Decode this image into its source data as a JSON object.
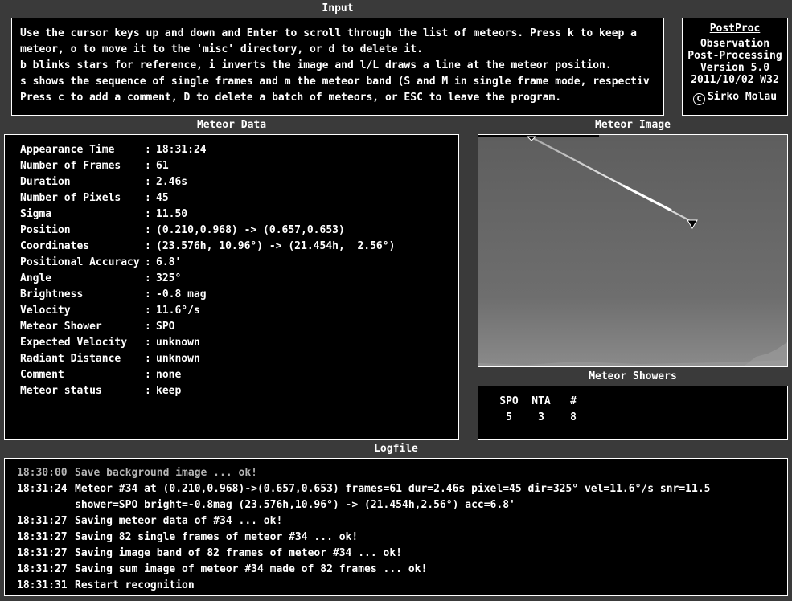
{
  "input": {
    "title": "Input",
    "lines": [
      "Use the cursor keys up and down and Enter to scroll through the list of meteors. Press k to keep a",
      "meteor, o to move it to the 'misc' directory, or d to delete it.",
      "b blinks stars for reference, i inverts the image and l/L draws a line at the meteor position.",
      "s shows the sequence of single frames and m the meteor band (S and M in single frame mode, respectiv",
      "Press c to add a comment, D to delete a batch of meteors, or ESC to leave the program."
    ]
  },
  "info": {
    "link": "PostProc",
    "line1": "Observation",
    "line2": "Post-Processing",
    "line3": "Version 5.0",
    "line4": "2011/10/02 W32",
    "copyright_symbol": "C",
    "copyright": "Sirko Molau"
  },
  "meteor_data": {
    "title": "Meteor Data",
    "separator": ":",
    "rows": [
      {
        "label": "Appearance Time",
        "value": "18:31:24"
      },
      {
        "label": "Number of Frames",
        "value": "61"
      },
      {
        "label": "Duration",
        "value": "2.46s"
      },
      {
        "label": "Number of Pixels",
        "value": "45"
      },
      {
        "label": "Sigma",
        "value": "11.50"
      },
      {
        "label": "Position",
        "value": "(0.210,0.968) -> (0.657,0.653)"
      },
      {
        "label": "Coordinates",
        "value": "(23.576h, 10.96°) -> (21.454h,  2.56°)"
      },
      {
        "label": "Positional Accuracy",
        "value": "6.8'"
      },
      {
        "label": "Angle",
        "value": "325°"
      },
      {
        "label": "Brightness",
        "value": "-0.8 mag"
      },
      {
        "label": "Velocity",
        "value": "11.6°/s"
      },
      {
        "label": "Meteor Shower",
        "value": "SPO"
      },
      {
        "label": "Expected Velocity",
        "value": "unknown"
      },
      {
        "label": "Radiant Distance",
        "value": "unknown"
      },
      {
        "label": "Comment",
        "value": "none"
      },
      {
        "label": "Meteor status",
        "value": "keep"
      }
    ]
  },
  "meteor_image": {
    "title": "Meteor Image",
    "start_marker_icon": "triangle-marker-icon",
    "end_marker_icon": "triangle-marker-icon",
    "sky_color": "#6b6b6b"
  },
  "meteor_showers": {
    "title": "Meteor Showers",
    "columns": [
      {
        "header": "SPO",
        "value": "5"
      },
      {
        "header": "NTA",
        "value": "3"
      },
      {
        "header": "#",
        "value": "8"
      }
    ]
  },
  "logfile": {
    "title": "Logfile",
    "entries": [
      {
        "time": "18:30:00",
        "message": "Save background image ... ok!",
        "dim": true
      },
      {
        "time": "18:31:24",
        "message": "Meteor #34 at (0.210,0.968)->(0.657,0.653) frames=61 dur=2.46s pixel=45 dir=325° vel=11.6°/s snr=11.5",
        "dim": false
      },
      {
        "time": "",
        "message": "shower=SPO bright=-0.8mag (23.576h,10.96°) -> (21.454h,2.56°) acc=6.8'",
        "dim": false
      },
      {
        "time": "18:31:27",
        "message": "Saving meteor data of #34 ... ok!",
        "dim": false
      },
      {
        "time": "18:31:27",
        "message": "Saving 82 single frames of meteor #34 ... ok!",
        "dim": false
      },
      {
        "time": "18:31:27",
        "message": "Saving image band of 82 frames of meteor #34 ... ok!",
        "dim": false
      },
      {
        "time": "18:31:27",
        "message": "Saving sum image of meteor #34 made of 82 frames ... ok!",
        "dim": false
      },
      {
        "time": "18:31:31",
        "message": "Restart recognition",
        "dim": false
      }
    ]
  }
}
